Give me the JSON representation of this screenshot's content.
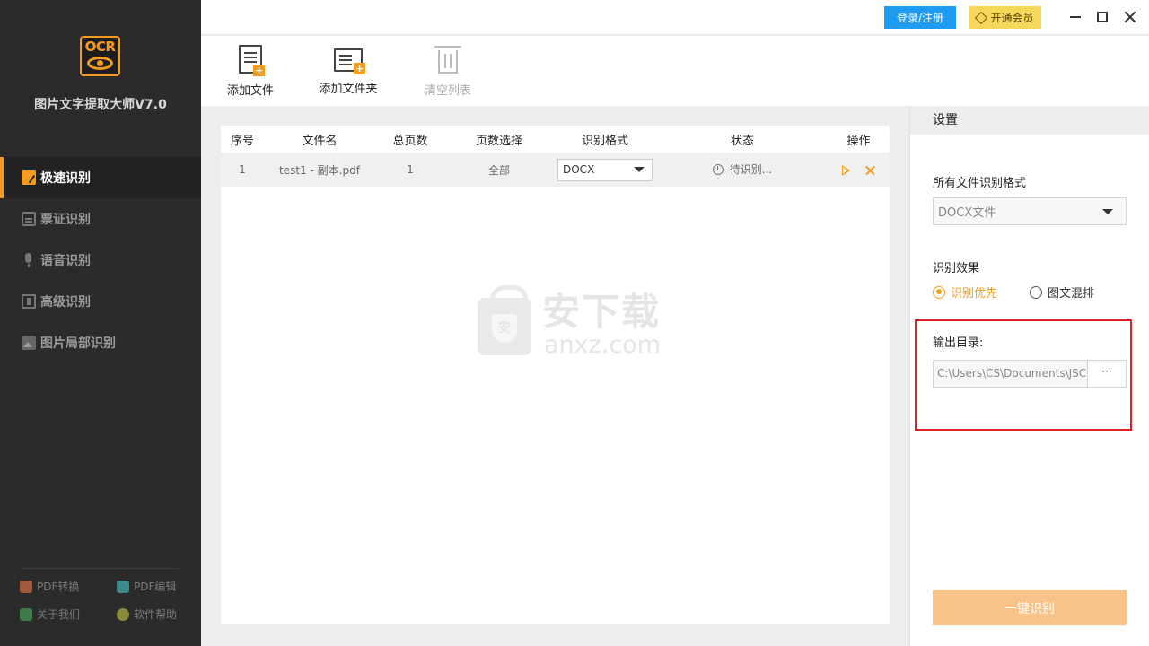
{
  "app": {
    "logo_text": "OCR",
    "title": "图片文字提取大师V7.0"
  },
  "sidebar": {
    "items": [
      {
        "label": "极速识别",
        "icon": "lightning-edit-icon",
        "active": true
      },
      {
        "label": "票证识别",
        "icon": "ticket-icon",
        "active": false
      },
      {
        "label": "语音识别",
        "icon": "microphone-icon",
        "active": false
      },
      {
        "label": "高级识别",
        "icon": "advanced-scan-icon",
        "active": false
      },
      {
        "label": "图片局部识别",
        "icon": "image-region-icon",
        "active": false
      }
    ],
    "links": [
      {
        "label": "PDF转换",
        "icon": "pdf-convert-icon"
      },
      {
        "label": "PDF编辑",
        "icon": "pdf-edit-icon"
      },
      {
        "label": "关于我们",
        "icon": "about-icon"
      },
      {
        "label": "软件帮助",
        "icon": "help-icon"
      }
    ]
  },
  "topbar": {
    "login_label": "登录/注册",
    "vip_label": "开通会员",
    "accent": "#f39c1f",
    "login_color": "#1f9cf0"
  },
  "toolbar": {
    "add_file": "添加文件",
    "add_folder": "添加文件夹",
    "clear_list": "清空列表"
  },
  "table": {
    "headers": [
      "序号",
      "文件名",
      "总页数",
      "页数选择",
      "识别格式",
      "状态",
      "操作"
    ],
    "rows": [
      {
        "index": "1",
        "filename": "test1 - 副本.pdf",
        "pages": "1",
        "page_select": "全部",
        "format": "DOCX",
        "status": "待识别..."
      }
    ]
  },
  "watermark": {
    "shield_char": "安",
    "cn": "安下载",
    "en": "anxz.com"
  },
  "settings": {
    "title": "设置",
    "format_label": "所有文件识别格式",
    "format_value": "DOCX文件",
    "effect_label": "识别效果",
    "effect_options": [
      "识别优先",
      "图文混排"
    ],
    "effect_selected": "识别优先",
    "output_label": "输出目录:",
    "output_path": "C:\\Users\\CS\\Documents\\JSCOCR",
    "browse_label": "···",
    "start_label": "一键识别"
  }
}
